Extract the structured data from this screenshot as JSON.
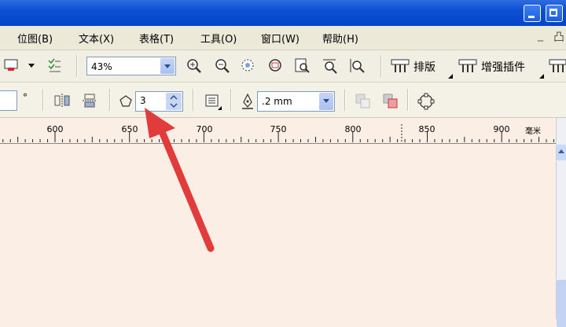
{
  "menu": {
    "items": [
      "位图(B)",
      "文本(X)",
      "表格(T)",
      "工具(O)",
      "窗口(W)",
      "帮助(H)"
    ],
    "mdi_controls": [
      "_",
      "凸"
    ]
  },
  "toolbar1": {
    "zoom_value": "43%",
    "paiban_label": "排版",
    "plugin_label": "增强插件"
  },
  "toolbar2": {
    "degree_symbol": "°",
    "polygon_sides": "3",
    "outline_width": ".2 mm"
  },
  "ruler": {
    "labels": [
      "600",
      "650",
      "700",
      "750",
      "800",
      "850",
      "900"
    ],
    "unit": "毫米"
  },
  "colors": {
    "titlebar": "#0a4fd3",
    "canvas": "#fbefe5",
    "arrow": "#e23b3b"
  }
}
